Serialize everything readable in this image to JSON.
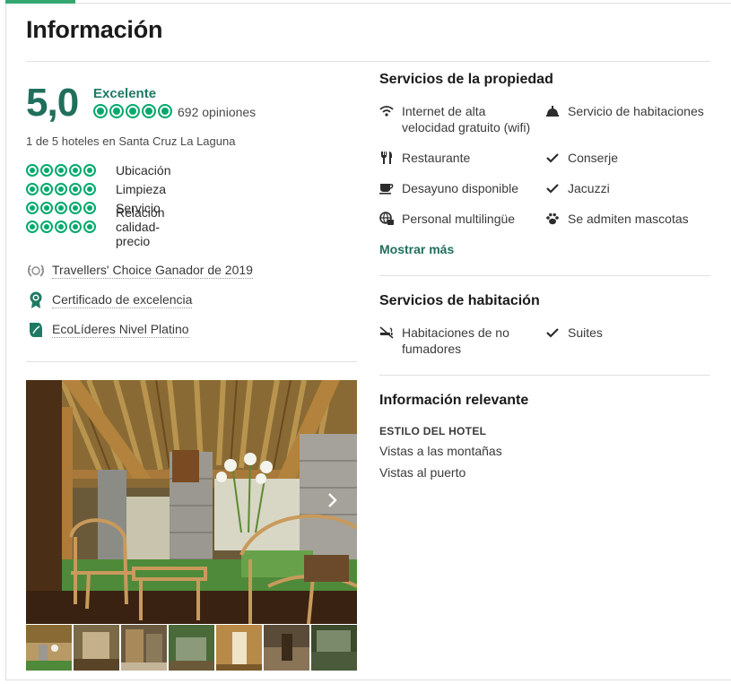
{
  "header": {
    "title": "Información"
  },
  "rating": {
    "score": "5,0",
    "label": "Excelente",
    "bubbles": 5,
    "review_count": "692 opiniones",
    "ranking": "1 de 5 hoteles en Santa Cruz La Laguna"
  },
  "sub_ratings": [
    {
      "label": "Ubicación",
      "bubbles": 5
    },
    {
      "label": "Limpieza",
      "bubbles": 5
    },
    {
      "label": "Servicio",
      "bubbles": 5
    },
    {
      "label": "Relación calidad-precio",
      "bubbles": 5
    }
  ],
  "awards": [
    {
      "icon": "laurel-icon",
      "label": "Travellers' Choice Ganador de 2019"
    },
    {
      "icon": "certificate-icon",
      "label": "Certificado de excelencia"
    },
    {
      "icon": "leaf-icon",
      "label": "EcoLíderes Nivel Platino"
    }
  ],
  "property_amenities": {
    "title": "Servicios de la propiedad",
    "items": [
      {
        "icon": "wifi-icon",
        "label": "Internet de alta velocidad gratuito (wifi)"
      },
      {
        "icon": "room-service-icon",
        "label": "Servicio de habitaciones"
      },
      {
        "icon": "restaurant-icon",
        "label": "Restaurante"
      },
      {
        "icon": "check-icon",
        "label": "Conserje"
      },
      {
        "icon": "coffee-icon",
        "label": "Desayuno disponible"
      },
      {
        "icon": "check-icon",
        "label": "Jacuzzi"
      },
      {
        "icon": "multilingual-icon",
        "label": "Personal multilingüe"
      },
      {
        "icon": "paw-icon",
        "label": "Se admiten mascotas"
      }
    ],
    "show_more": "Mostrar más"
  },
  "room_amenities": {
    "title": "Servicios de habitación",
    "items": [
      {
        "icon": "no-smoking-icon",
        "label": "Habitaciones de no fumadores"
      },
      {
        "icon": "check-icon",
        "label": "Suites"
      }
    ]
  },
  "relevant_info": {
    "title": "Información relevante",
    "style_heading": "ESTILO DEL HOTEL",
    "styles": [
      "Vistas a las montañas",
      "Vistas al puerto"
    ]
  },
  "colors": {
    "accent": "#00aa6c",
    "score": "#1f6f5c",
    "tab_accent": "#34a870"
  }
}
